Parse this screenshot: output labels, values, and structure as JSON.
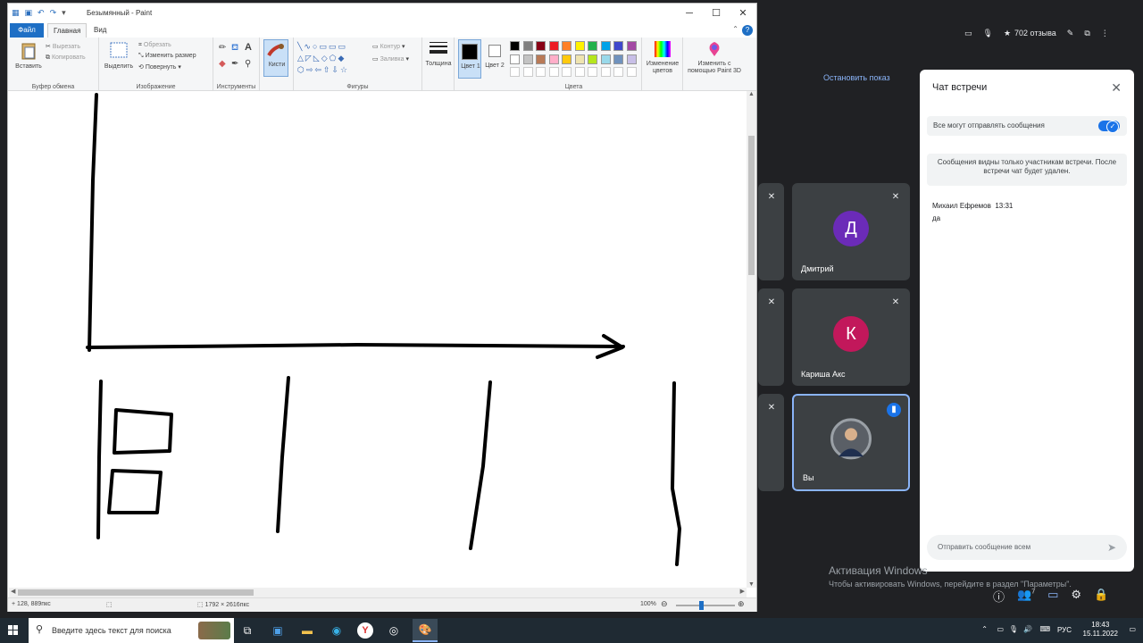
{
  "meet": {
    "reviews": "702 отзыва",
    "stop_presenting": "Остановить показ",
    "participants": [
      {
        "name": "Дмитрий",
        "initial": "Д",
        "color": "#6b2bb8"
      },
      {
        "name": "Кариша Акс",
        "initial": "К",
        "color": "#c2185b"
      },
      {
        "name": "Вы",
        "initial": "",
        "color": "#5a5f66"
      }
    ],
    "chat": {
      "title": "Чат встречи",
      "allow_label": "Все могут отправлять сообщения",
      "notice": "Сообщения видны только участникам встречи. После встречи чат будет удален.",
      "message_author": "Михаил Ефремов",
      "message_time": "13:31",
      "message_text": "да",
      "input_placeholder": "Отправить сообщение всем"
    },
    "activation_title": "Активация Windows",
    "activation_text": "Чтобы активировать Windows, перейдите в раздел \"Параметры\".",
    "people_count": "7"
  },
  "paint": {
    "window_title": "Безымянный - Paint",
    "tabs": {
      "file": "Файл",
      "home": "Главная",
      "view": "Вид"
    },
    "ribbon": {
      "paste": "Вставить",
      "cut": "Вырезать",
      "copy": "Копировать",
      "clipboard_group": "Буфер обмена",
      "select": "Выделить",
      "crop": "Обрезать",
      "resize": "Изменить размер",
      "rotate": "Повернуть",
      "image_group": "Изображение",
      "tools_group": "Инструменты",
      "brushes": "Кисти",
      "outline": "Контур",
      "fill": "Заливка",
      "shapes_group": "Фигуры",
      "size": "Толщина",
      "color1": "Цвет 1",
      "color2": "Цвет 2",
      "colors_group": "Цвета",
      "edit_colors": "Изменение цветов",
      "paint3d": "Изменить с помощью Paint 3D"
    },
    "palette": [
      "#000000",
      "#7f7f7f",
      "#880015",
      "#ed1c24",
      "#ff7f27",
      "#fff200",
      "#22b14c",
      "#00a2e8",
      "#3f48cc",
      "#a349a4",
      "#ffffff",
      "#c3c3c3",
      "#b97a57",
      "#ffaec9",
      "#ffc90e",
      "#efe4b0",
      "#b5e61d",
      "#99d9ea",
      "#7092be",
      "#c8bfe7"
    ],
    "status": {
      "cursor_pos": "128, 889пкс",
      "canvas_size": "1792 × 2616пкс",
      "zoom": "100%"
    }
  },
  "taskbar": {
    "search_placeholder": "Введите здесь текст для поиска",
    "language": "РУС",
    "time": "18:43",
    "date": "15.11.2022"
  }
}
